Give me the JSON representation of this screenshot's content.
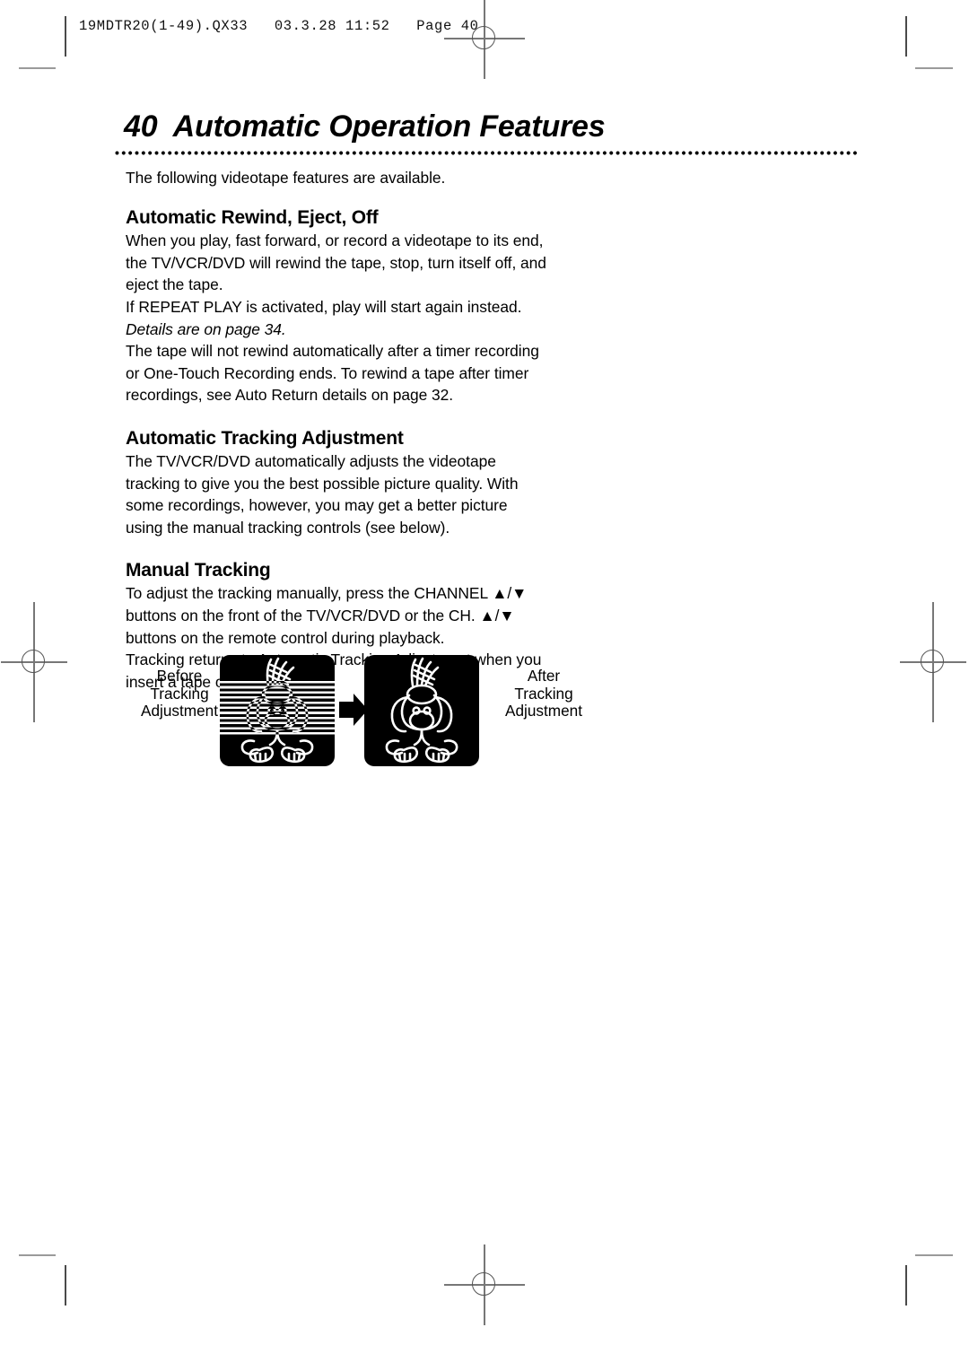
{
  "print_header": {
    "slug": "19MDTR20(1-49).QX33   03.3.28 11:52   Page 40"
  },
  "page": {
    "number": "40",
    "title": "40  Automatic Operation Features",
    "intro": "The following videotape features are available."
  },
  "sections": [
    {
      "heading": "Automatic Rewind, Eject, Off",
      "paragraphs": [
        "When you play, fast forward, or record a videotape to its end, the TV/VCR/DVD will rewind the tape, stop, turn itself off, and eject the tape.",
        "If REPEAT PLAY is activated, play will start again instead.",
        "Details are on page 34.",
        "The tape will not rewind automatically after a timer recording or One-Touch Recording ends. To rewind a tape after timer recordings, see Auto Return details on page 32."
      ]
    },
    {
      "heading": "Automatic Tracking Adjustment",
      "paragraphs": [
        "The TV/VCR/DVD automatically adjusts the videotape tracking to give you the best possible picture quality. With some recordings, however, you may get a better picture using the manual tracking controls (see below)."
      ]
    },
    {
      "heading": "Manual Tracking",
      "paragraphs": [
        "To adjust the tracking manually, press the CHANNEL ▲/▼ buttons on the front of the TV/VCR/DVD or the CH. ▲/▼ buttons on the remote control during playback.",
        "Tracking returns to Automatic Tracking Adjustment when you insert a tape or press STOP ■."
      ]
    }
  ],
  "figure": {
    "before_label": "Before\nTracking\nAdjustment",
    "after_label": "After\nTracking\nAdjustment",
    "arrow_icon": "arrow-right-icon",
    "before_image": "tv-screen-untracked",
    "after_image": "tv-screen-tracked"
  },
  "colors": {
    "ink": "#000000",
    "paper": "#ffffff",
    "crop_mark": "#777777"
  }
}
